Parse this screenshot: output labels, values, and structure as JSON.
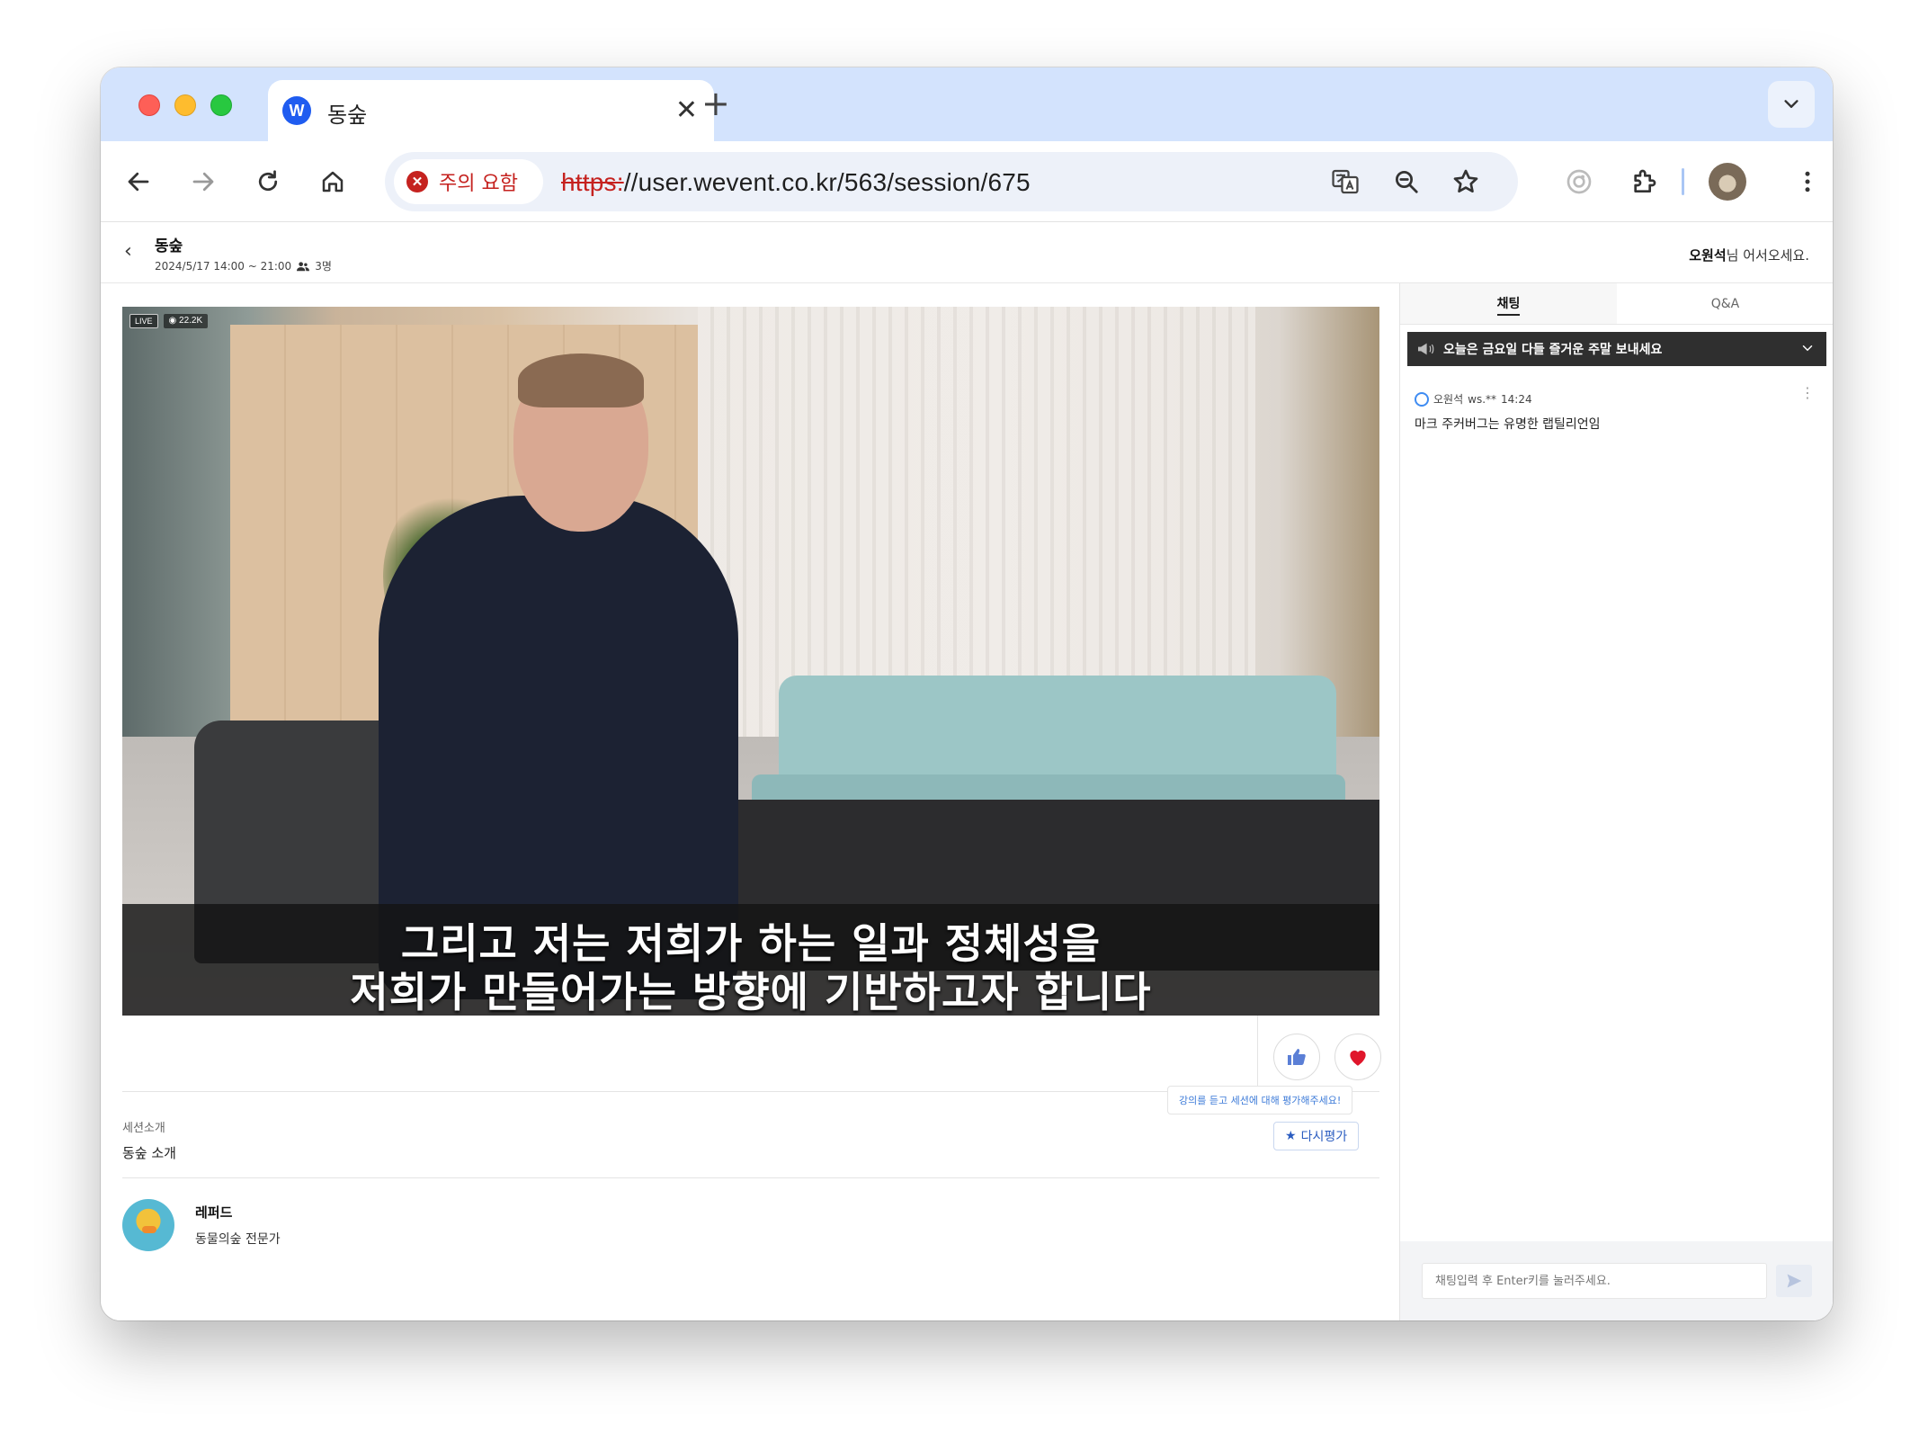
{
  "browser": {
    "tab_title": "동숲",
    "favicon_letter": "W",
    "security_chip": "주의 요함",
    "url_scheme": "https:",
    "url_rest": "//user.wevent.co.kr/563/session/675"
  },
  "header": {
    "title": "동숲",
    "datetime": "2024/5/17 14:00 ~ 21:00",
    "attendees": "3명",
    "welcome_name": "오원석",
    "welcome_suffix": "님 어서오세요."
  },
  "video": {
    "live_badge": "LIVE",
    "views": "22.2K",
    "subtitle_line1": "그리고 저는 저희가 하는 일과 정체성을",
    "subtitle_line2": "저희가 만들어가는 방향에 기반하고자 합니다"
  },
  "rating": {
    "tooltip": "강의를 듣고 세션에 대해 평가해주세요!",
    "button": "다시평가"
  },
  "session": {
    "intro_label": "세션소개",
    "intro_text": "동숲 소개"
  },
  "speaker": {
    "name": "레퍼드",
    "role": "동물의숲 전문가"
  },
  "chat": {
    "tabs": [
      {
        "label": "채팅",
        "active": true
      },
      {
        "label": "Q&A",
        "active": false
      }
    ],
    "notice": "오늘은 금요일 다들 즐거운 주말 보내세요",
    "messages": [
      {
        "user": "오원석",
        "id": "ws.**",
        "time": "14:24",
        "text": "마크 주커버그는 유명한 랩틸리언임"
      }
    ],
    "input_placeholder": "채팅입력 후 Enter키를 눌러주세요."
  },
  "colors": {
    "tabstrip": "#d3e3fd",
    "warning": "#c5221f",
    "accent_blue": "#1f5cf0",
    "notice_bg": "#2f2f2f"
  }
}
